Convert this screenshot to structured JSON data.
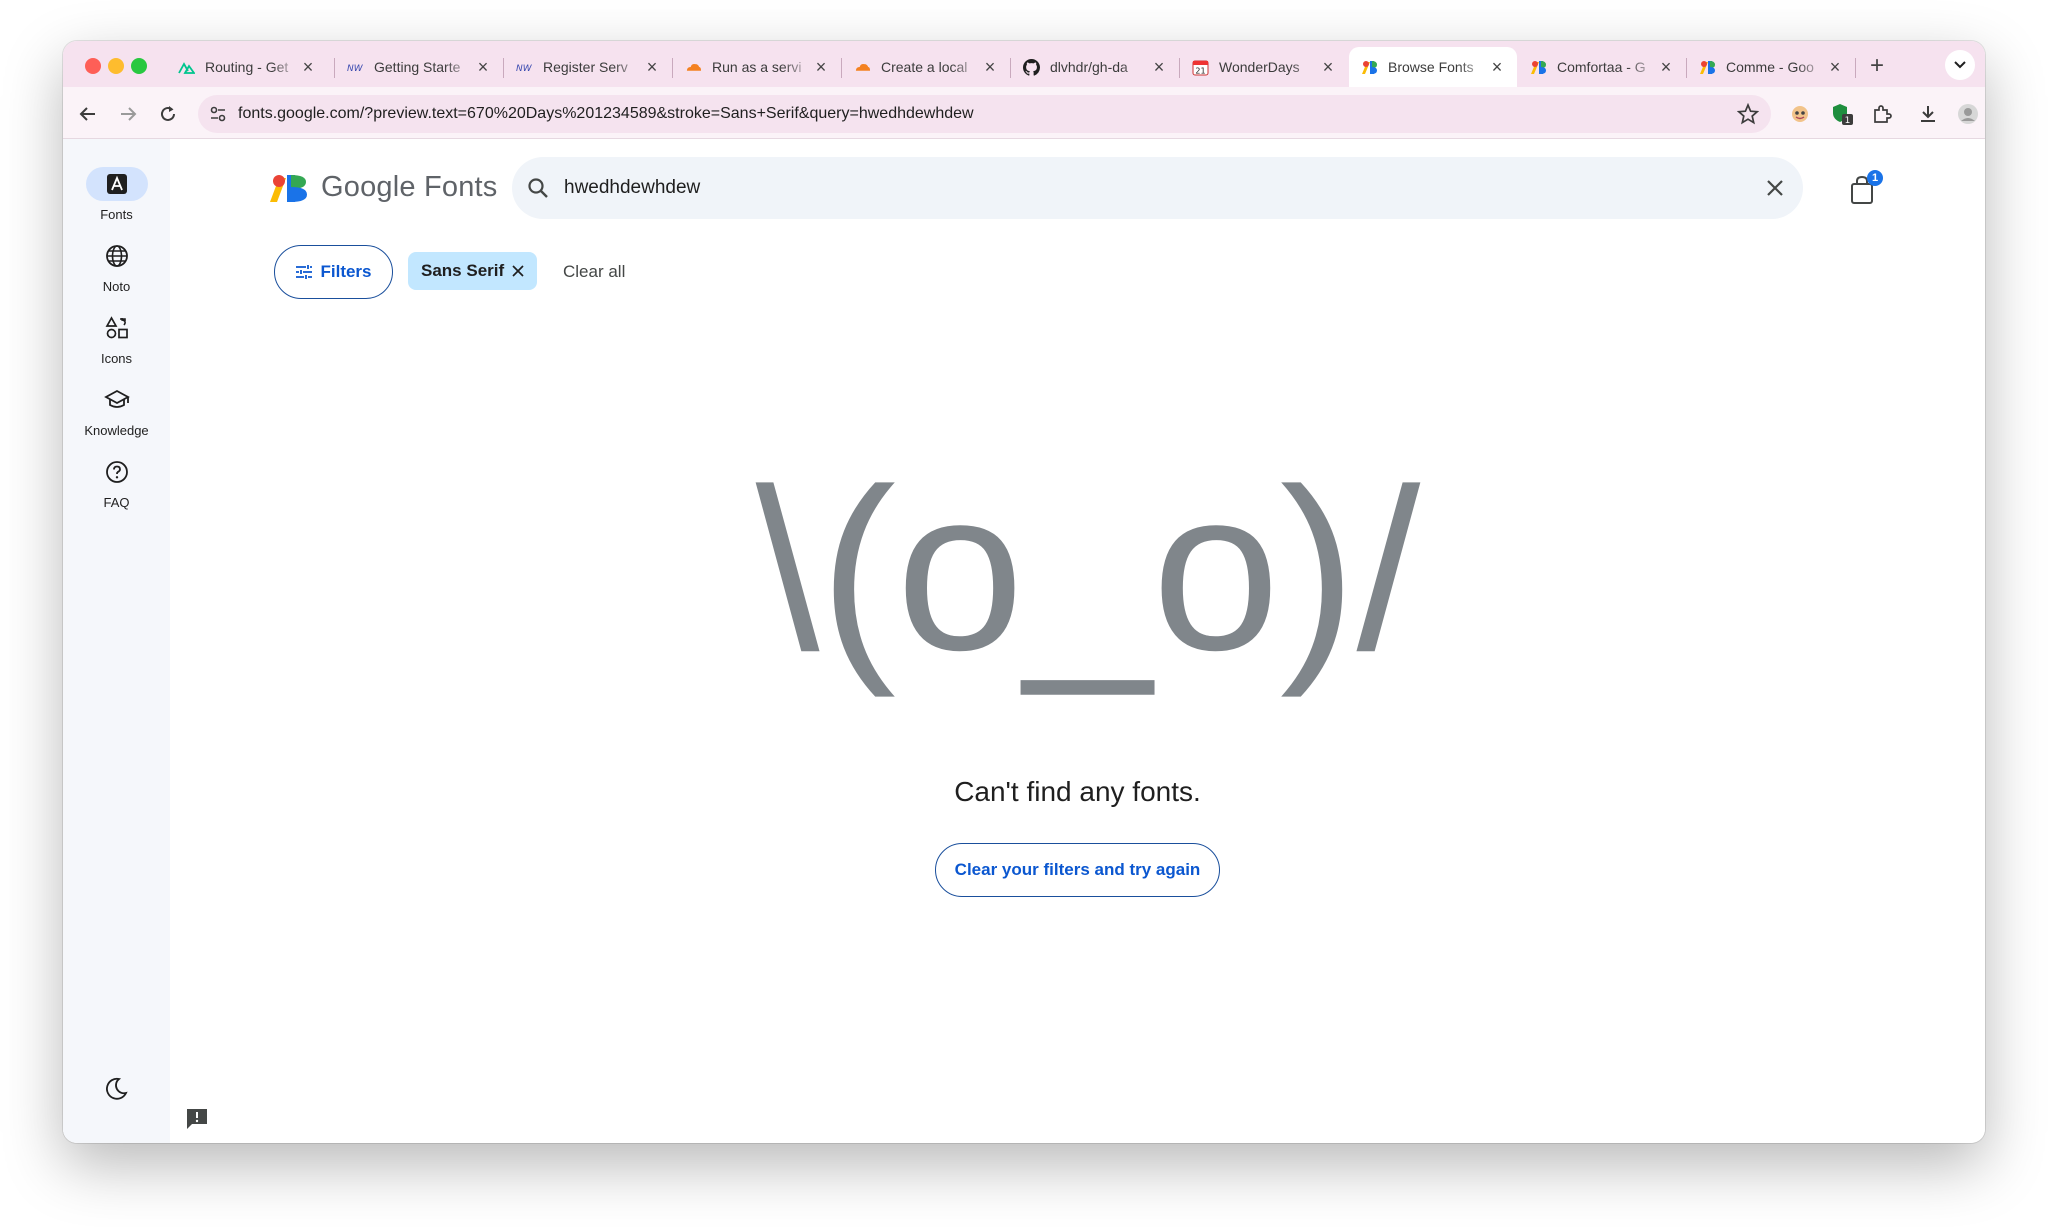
{
  "browser": {
    "tabs": [
      {
        "title": "Routing - Get",
        "icon": "nuxt-icon"
      },
      {
        "title": "Getting Starte",
        "icon": "nw-icon"
      },
      {
        "title": "Register Serv",
        "icon": "nw-icon"
      },
      {
        "title": "Run as a servi",
        "icon": "cloudflare-icon"
      },
      {
        "title": "Create a local",
        "icon": "cloudflare-icon"
      },
      {
        "title": "dlvhdr/gh-da",
        "icon": "github-icon"
      },
      {
        "title": "WonderDays",
        "icon": "calendar-icon"
      },
      {
        "title": "Browse Fonts",
        "icon": "google-fonts-icon",
        "active": true
      },
      {
        "title": "Comfortaa - G",
        "icon": "google-fonts-icon"
      },
      {
        "title": "Comme - Goo",
        "icon": "google-fonts-icon"
      }
    ],
    "url": "fonts.google.com/?preview.text=670%20Days%201234589&stroke=Sans+Serif&query=hwedhdewhdew",
    "extension_badge": "1",
    "calendar_day": "21"
  },
  "sidebar": {
    "items": [
      {
        "label": "Fonts",
        "icon": "font-icon",
        "active": true
      },
      {
        "label": "Noto",
        "icon": "globe-icon"
      },
      {
        "label": "Icons",
        "icon": "shapes-icon"
      },
      {
        "label": "Knowledge",
        "icon": "school-icon"
      },
      {
        "label": "FAQ",
        "icon": "help-icon"
      }
    ]
  },
  "header": {
    "logo_text": "Google Fonts",
    "search_value": "hwedhdewhdew",
    "cart_count": "1"
  },
  "filters": {
    "filters_label": "Filters",
    "chip_label": "Sans Serif",
    "clear_all_label": "Clear all"
  },
  "empty_state": {
    "face": "\\(o_o)/",
    "message": "Can't find any fonts.",
    "retry_label": "Clear your filters and try again"
  },
  "colors": {
    "accent": "#0b57d0",
    "chip_bg": "#c2e7ff",
    "tabstrip_bg": "#f6e2ef",
    "face_color": "#80868b"
  }
}
